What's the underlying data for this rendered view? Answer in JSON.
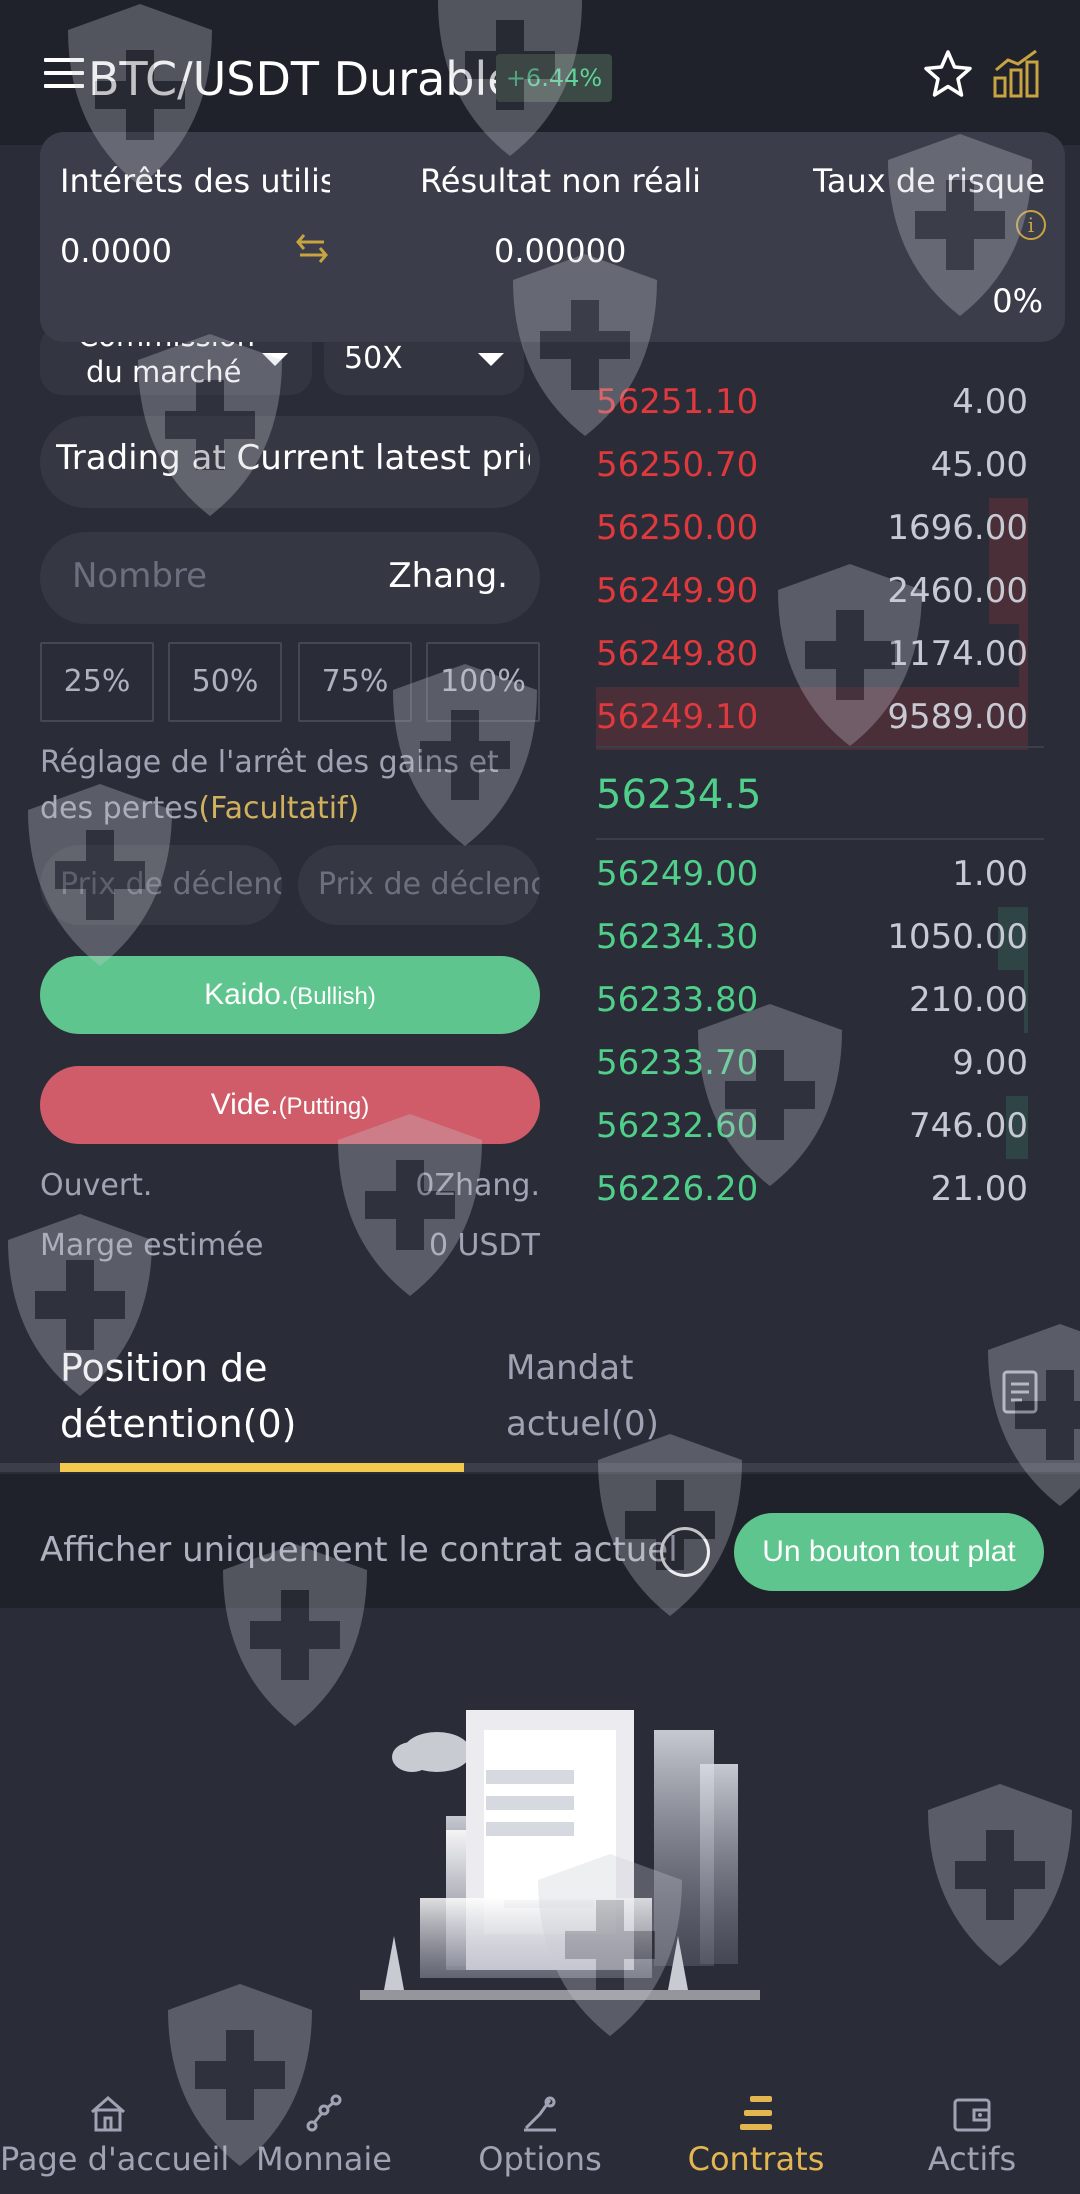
{
  "header": {
    "title": "BTC/USDT Durable",
    "change": "+6.44%"
  },
  "summary": {
    "user_interest_label": "Intérêts des utilisa",
    "user_interest_value": "0.0000",
    "unrealized_label": "Résultat non réalisé",
    "unrealized_value": "0.00000",
    "risk_label": "Taux de risque",
    "risk_value": "0%"
  },
  "form": {
    "order_type_line1": "Commission",
    "order_type_line2": "du marché",
    "leverage": "50X",
    "price_mode": "Trading at Current latest price",
    "amount_placeholder": "Nombre",
    "amount_unit": "Zhang.",
    "percent_buttons": [
      "25%",
      "50%",
      "75%",
      "100%"
    ],
    "tp_sl_label": "Réglage de l'arrêt des gains et des pertes",
    "tp_sl_optional": "(Facultatif)",
    "trigger_placeholder_1": "Prix de déclenchement",
    "trigger_placeholder_2": "Prix de déclenchement",
    "buy_label": "Kaido.",
    "buy_sub": "(Bullish)",
    "sell_label": "Vide.",
    "sell_sub": "(Putting)",
    "open_label": "Ouvert.",
    "open_value": "0Zhang.",
    "margin_label": "Marge estimée",
    "margin_value": "0 USDT"
  },
  "orderbook": {
    "asks": [
      {
        "price": "56251.10",
        "amount": "4.00",
        "depth": 0.0
      },
      {
        "price": "56250.70",
        "amount": "45.00",
        "depth": 0.0
      },
      {
        "price": "56250.00",
        "amount": "1696.00",
        "depth": 0.09
      },
      {
        "price": "56249.90",
        "amount": "2460.00",
        "depth": 0.09
      },
      {
        "price": "56249.80",
        "amount": "1174.00",
        "depth": 0.02
      },
      {
        "price": "56249.10",
        "amount": "9589.00",
        "depth": 1.0
      }
    ],
    "last_price": "56234.5",
    "bids": [
      {
        "price": "56249.00",
        "amount": "1.00",
        "depth": 0.0
      },
      {
        "price": "56234.30",
        "amount": "1050.00",
        "depth": 0.07
      },
      {
        "price": "56233.80",
        "amount": "210.00",
        "depth": 0.01
      },
      {
        "price": "56233.70",
        "amount": "9.00",
        "depth": 0.0
      },
      {
        "price": "56232.60",
        "amount": "746.00",
        "depth": 0.05
      },
      {
        "price": "56226.20",
        "amount": "21.00",
        "depth": 0.0
      }
    ]
  },
  "tabs": {
    "positions_line1": "Position de",
    "positions_line2": "détention(0)",
    "orders_line1": "Mandat",
    "orders_line2": "actuel(0)"
  },
  "filter": {
    "label": "Afficher uniquement le contrat actuel",
    "flat_button": "Un bouton tout plat"
  },
  "nav": [
    {
      "label": "Page d'accueil",
      "icon": "home-icon"
    },
    {
      "label": "Monnaie",
      "icon": "nodes-icon"
    },
    {
      "label": "Options",
      "icon": "options-icon"
    },
    {
      "label": "Contrats",
      "icon": "contracts-icon"
    },
    {
      "label": "Actifs",
      "icon": "wallet-icon"
    }
  ],
  "colors": {
    "ask": "#e0393d",
    "bid": "#4fcf8a",
    "accent": "#f2c94c",
    "buy_button": "#5fc58e",
    "sell_button": "#cf5c68"
  }
}
